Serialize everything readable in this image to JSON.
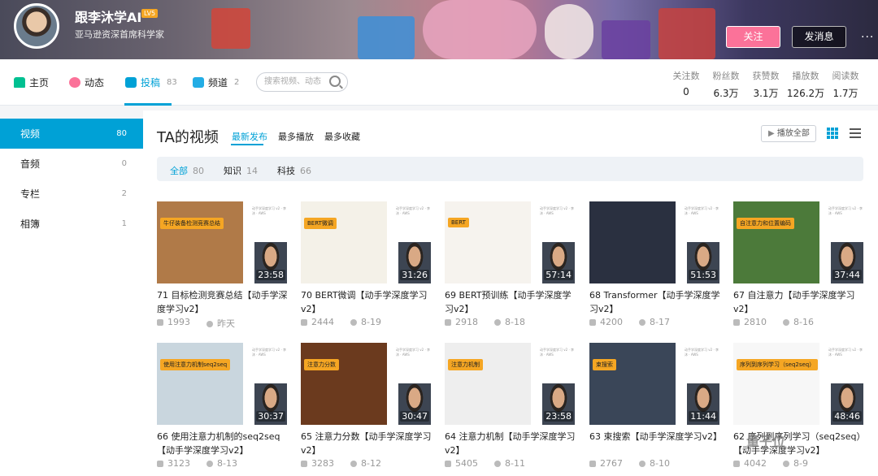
{
  "profile": {
    "name": "跟李沐学AI",
    "level": "LV5",
    "sign": "亚马逊资深首席科学家",
    "follow_label": "关注",
    "message_label": "发消息",
    "more_label": "···"
  },
  "nav": {
    "items": [
      {
        "label": "主页",
        "count": ""
      },
      {
        "label": "动态",
        "count": ""
      },
      {
        "label": "投稿",
        "count": "83"
      },
      {
        "label": "频道",
        "count": "2"
      }
    ],
    "search_placeholder": "搜索视频、动态"
  },
  "stats": [
    {
      "key": "关注数",
      "value": "0"
    },
    {
      "key": "粉丝数",
      "value": "6.3万"
    },
    {
      "key": "获赞数",
      "value": "3.1万"
    },
    {
      "key": "播放数",
      "value": "126.2万"
    },
    {
      "key": "阅读数",
      "value": "1.7万"
    }
  ],
  "sidebar": {
    "items": [
      {
        "label": "视频",
        "count": "80"
      },
      {
        "label": "音频",
        "count": "0"
      },
      {
        "label": "专栏",
        "count": "2"
      },
      {
        "label": "相簿",
        "count": "1"
      }
    ]
  },
  "main": {
    "title": "TA的视频",
    "tabs": [
      "最新发布",
      "最多播放",
      "最多收藏"
    ],
    "play_all": "播放全部",
    "filters": [
      {
        "label": "全部",
        "count": "80"
      },
      {
        "label": "知识",
        "count": "14"
      },
      {
        "label": "科技",
        "count": "66"
      }
    ]
  },
  "videos": [
    {
      "title": "71 目标检测竞赛总结【动手学深度学习v2】",
      "duration": "23:58",
      "plays": "1993",
      "date": "昨天",
      "tag": "牛仔装备检测竞赛总结"
    },
    {
      "title": "70 BERT微调【动手学深度学习v2】",
      "duration": "31:26",
      "plays": "2444",
      "date": "8-19",
      "tag": "BERT微调"
    },
    {
      "title": "69 BERT预训练【动手学深度学习v2】",
      "duration": "57:14",
      "plays": "2918",
      "date": "8-18",
      "tag": "BERT"
    },
    {
      "title": "68 Transformer【动手学深度学习v2】",
      "duration": "51:53",
      "plays": "4200",
      "date": "8-17",
      "tag": ""
    },
    {
      "title": "67 自注意力【动手学深度学习v2】",
      "duration": "37:44",
      "plays": "2810",
      "date": "8-16",
      "tag": "自注意力和位置编码"
    },
    {
      "title": "66 使用注意力机制的seq2seq【动手学深度学习v2】",
      "duration": "30:37",
      "plays": "3123",
      "date": "8-13",
      "tag": "使用注意力机制seq2seq"
    },
    {
      "title": "65 注意力分数【动手学深度学习v2】",
      "duration": "30:47",
      "plays": "3283",
      "date": "8-12",
      "tag": "注意力分数"
    },
    {
      "title": "64 注意力机制【动手学深度学习v2】",
      "duration": "23:58",
      "plays": "5405",
      "date": "8-11",
      "tag": "注意力机制"
    },
    {
      "title": "63 束搜索【动手学深度学习v2】",
      "duration": "11:44",
      "plays": "2767",
      "date": "8-10",
      "tag": "束搜索"
    },
    {
      "title": "62 序列到序列学习（seq2seq）【动手学深度学习v2】",
      "duration": "48:46",
      "plays": "4042",
      "date": "8-9",
      "tag": "序列到序列学习（seq2seq）"
    }
  ],
  "thumb_watermark": "动手学深度学习 v2 · 李沐 · AWS",
  "watermark": "量子位"
}
